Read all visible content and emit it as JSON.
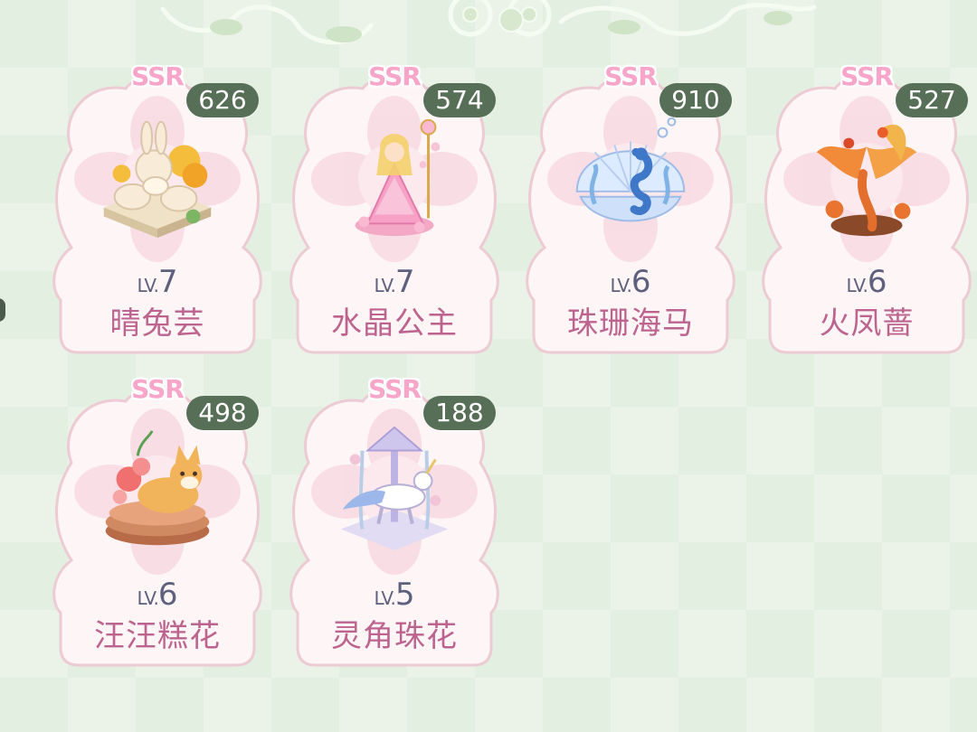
{
  "colors": {
    "background": "#e3efe1",
    "card_fill": "#fdf4f6",
    "card_border": "#ecc9d3",
    "ssr_pink": "#f7a5c8",
    "count_badge": "#566f56",
    "level_text": "#5e617d",
    "name_text": "#bd648e"
  },
  "level_prefix": "LV.",
  "cards": [
    {
      "rarity": "SSR",
      "count": "626",
      "level": "7",
      "name": "晴兔芸",
      "icon": "bunny-garden-icon"
    },
    {
      "rarity": "SSR",
      "count": "574",
      "level": "7",
      "name": "水晶公主",
      "icon": "crystal-princess-icon"
    },
    {
      "rarity": "SSR",
      "count": "910",
      "level": "6",
      "name": "珠珊海马",
      "icon": "coral-seahorse-icon"
    },
    {
      "rarity": "SSR",
      "count": "527",
      "level": "6",
      "name": "火凤蔷",
      "icon": "fire-phoenix-icon"
    },
    {
      "rarity": "SSR",
      "count": "498",
      "level": "6",
      "name": "汪汪糕花",
      "icon": "corgi-cake-icon"
    },
    {
      "rarity": "SSR",
      "count": "188",
      "level": "5",
      "name": "灵角珠花",
      "icon": "unicorn-carousel-icon"
    }
  ]
}
